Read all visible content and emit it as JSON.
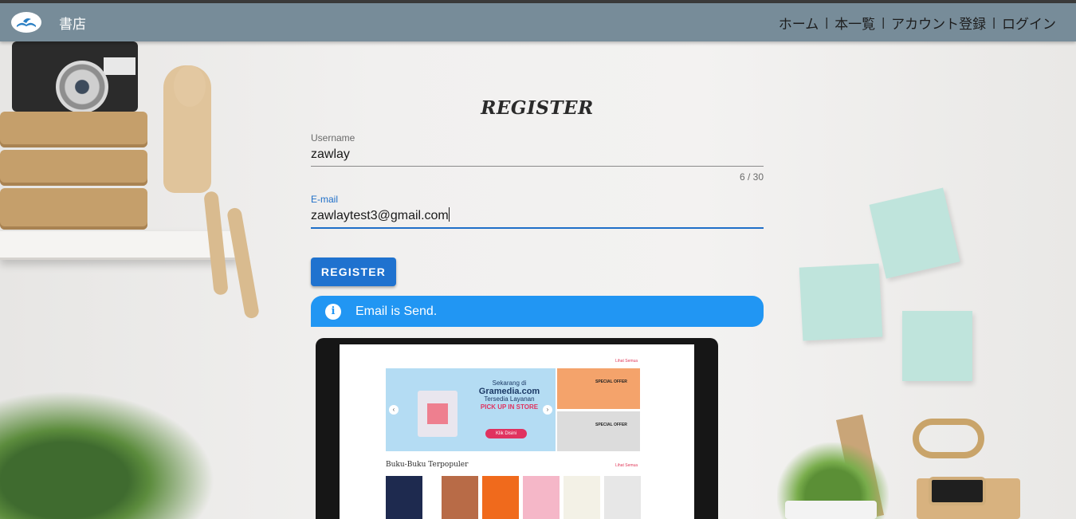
{
  "app": {
    "brand": "書店",
    "logo_icon": "book-bird-logo-icon"
  },
  "nav": {
    "items": [
      {
        "label": "ホーム"
      },
      {
        "label": "本一覧"
      },
      {
        "label": "アカウント登録"
      },
      {
        "label": "ログイン"
      }
    ],
    "separator": "|"
  },
  "form": {
    "title": "REGISTER",
    "username": {
      "label": "Username",
      "value": "zawlay",
      "counter": "6 / 30"
    },
    "email": {
      "label": "E-mail",
      "value": "zawlaytest3@gmail.com"
    },
    "submit_label": "REGISTER"
  },
  "alert": {
    "icon": "info-icon",
    "text": "Email is Send."
  },
  "laptop_screen": {
    "see_all_top": "Lihat Semua",
    "banner_lines": [
      "Sekarang di",
      "Gramedia.com",
      "Tersedia Layanan",
      "PICK UP IN STORE"
    ],
    "banner_button": "Klik Disini",
    "promo_top": "SPECIAL OFFER",
    "promo_bottom": "SPECIAL OFFER",
    "section_title": "Buku-Buku Terpopuler",
    "see_all_section": "Lihat Semua"
  },
  "colors": {
    "navbar": "#778c99",
    "primary": "#1f72cf",
    "alert": "#2196f3",
    "focus": "#1f6fc8"
  }
}
